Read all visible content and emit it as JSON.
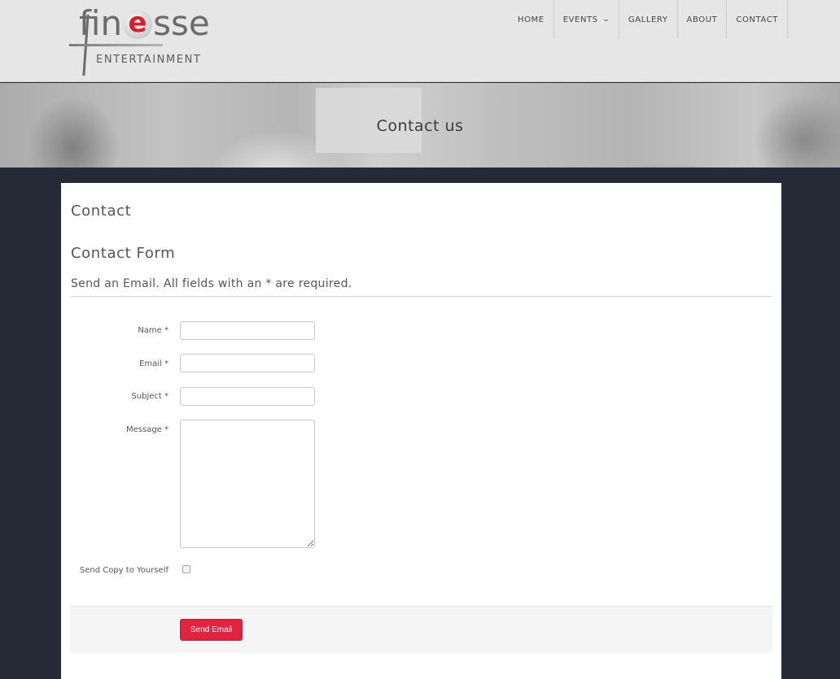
{
  "brand": {
    "logo_word_pre": "fin",
    "logo_word_e": "e",
    "logo_word_post": "sse",
    "logo_tagline": "ENTERTAINMENT"
  },
  "nav": {
    "items": [
      {
        "label": "HOME"
      },
      {
        "label": "EVENTS",
        "has_dropdown": true
      },
      {
        "label": "GALLERY"
      },
      {
        "label": "ABOUT"
      },
      {
        "label": "CONTACT"
      }
    ],
    "dropdown_icon": "chevron-down-icon"
  },
  "banner": {
    "title": "Contact us"
  },
  "content": {
    "heading": "Contact",
    "form_heading": "Contact Form",
    "legend": "Send an Email. All fields with an * are required.",
    "fields": {
      "name_label": "Name *",
      "name_value": "",
      "email_label": "Email *",
      "email_value": "",
      "subject_label": "Subject *",
      "subject_value": "",
      "message_label": "Message *",
      "message_value": "",
      "copy_label": "Send Copy to Yourself",
      "copy_checked": false
    },
    "submit_label": "Send Email"
  },
  "colors": {
    "header_bg": "#e6e6e6",
    "page_bg": "#252a36",
    "accent": "#e3223d",
    "logo_red": "#d61f2b"
  }
}
